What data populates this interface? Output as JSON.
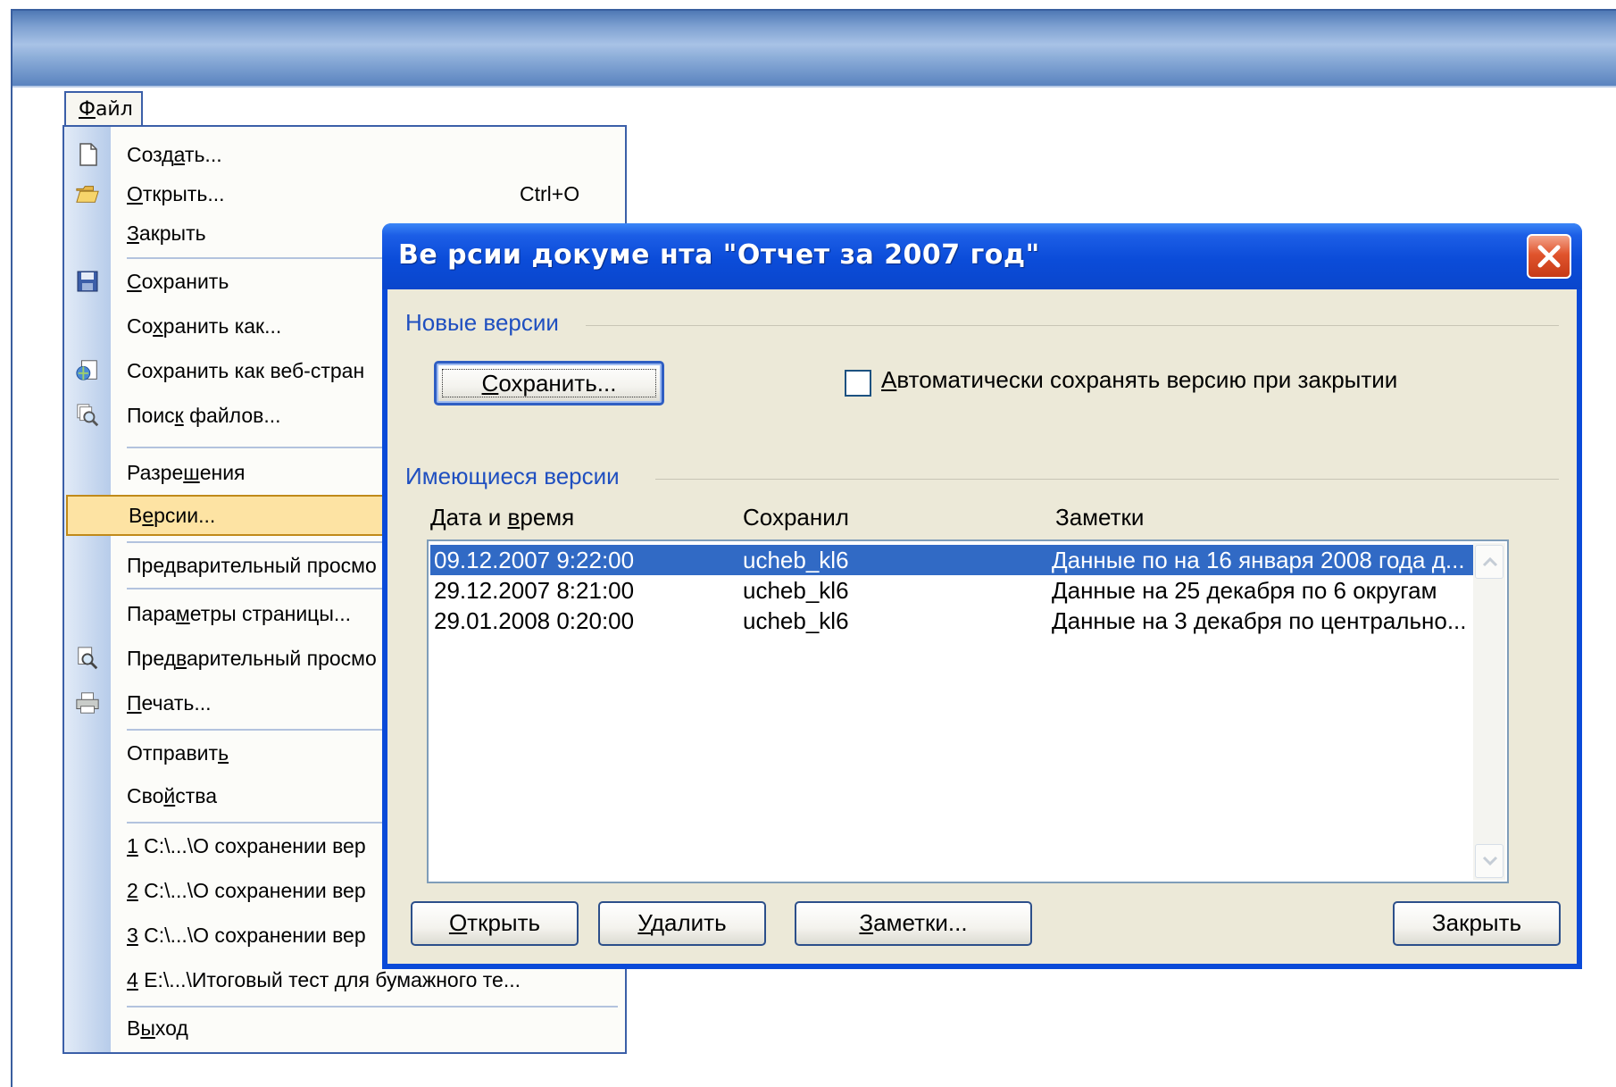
{
  "menu": {
    "tab": {
      "label": "Файл",
      "accel": "Ф",
      "rest": "айл"
    },
    "items": [
      {
        "pre": "Созд",
        "acc": "а",
        "post": "ть...",
        "shortcut": "",
        "icon": "new-document-icon"
      },
      {
        "pre": "",
        "acc": "О",
        "post": "ткрыть...",
        "shortcut": "Ctrl+O",
        "icon": "open-folder-icon"
      },
      {
        "pre": "",
        "acc": "З",
        "post": "акрыть",
        "shortcut": "",
        "icon": ""
      },
      {
        "pre": "",
        "acc": "С",
        "post": "охранить",
        "shortcut": "",
        "icon": "save-disk-icon"
      },
      {
        "pre": "Со",
        "acc": "х",
        "post": "ранить как...",
        "shortcut": "",
        "icon": ""
      },
      {
        "pre": "Сохранить как веб-стран",
        "acc": "",
        "post": "",
        "shortcut": "",
        "icon": "web-page-icon"
      },
      {
        "pre": "Поис",
        "acc": "к",
        "post": " файлов...",
        "shortcut": "",
        "icon": "file-search-icon"
      },
      {
        "pre": "Разре",
        "acc": "ш",
        "post": "ения",
        "shortcut": "",
        "icon": ""
      },
      {
        "pre": "В",
        "acc": "е",
        "post": "рсии...",
        "shortcut": "",
        "icon": ""
      },
      {
        "pre": "Предварительный просмо",
        "acc": "",
        "post": "",
        "shortcut": "",
        "icon": ""
      },
      {
        "pre": "Пара",
        "acc": "м",
        "post": "етры страницы...",
        "shortcut": "",
        "icon": ""
      },
      {
        "pre": "Пред",
        "acc": "в",
        "post": "арительный просмо",
        "shortcut": "",
        "icon": "print-preview-icon"
      },
      {
        "pre": "",
        "acc": "П",
        "post": "ечать...",
        "shortcut": "",
        "icon": "printer-icon"
      },
      {
        "pre": "Отправит",
        "acc": "ь",
        "post": "",
        "shortcut": "",
        "icon": ""
      },
      {
        "pre": "Сво",
        "acc": "й",
        "post": "ства",
        "shortcut": "",
        "icon": ""
      },
      {
        "pre": "",
        "acc": "1",
        "post": " C:\\...\\О сохранении вер",
        "shortcut": "",
        "icon": ""
      },
      {
        "pre": "",
        "acc": "2",
        "post": " C:\\...\\О сохранении вер",
        "shortcut": "",
        "icon": ""
      },
      {
        "pre": "",
        "acc": "3",
        "post": " C:\\...\\О сохранении вер",
        "shortcut": "",
        "icon": ""
      },
      {
        "pre": "",
        "acc": "4",
        "post": " E:\\...\\Итоговый тест для бумажного те...",
        "shortcut": "",
        "icon": ""
      },
      {
        "pre": "В",
        "acc": "ы",
        "post": "ход",
        "shortcut": "",
        "icon": ""
      }
    ]
  },
  "dialog": {
    "title": "Ве рсии докуме нта \"Отчет за 2007 год\"",
    "new_versions_label": "Новые версии",
    "save_button": {
      "pre": "",
      "acc": "С",
      "post": "охранить..."
    },
    "autosave_checkbox": {
      "pre": "",
      "acc": "А",
      "post": "втоматически сохранять версию при закрытии",
      "checked": false
    },
    "existing_versions_label": "Имеющиеся версии",
    "columns": {
      "date": {
        "pre": "Дата и ",
        "acc": "в",
        "post": "ремя"
      },
      "saved_by": "Сохранил",
      "notes": "Заметки"
    },
    "rows": [
      {
        "date": "09.12.2007 9:22:00",
        "saved_by": "ucheb_kl6",
        "notes": "Данные по на 16 января 2008 года д...",
        "selected": true
      },
      {
        "date": "29.12.2007 8:21:00",
        "saved_by": "ucheb_kl6",
        "notes": "Данные на 25 декабря по 6 округам",
        "selected": false
      },
      {
        "date": "29.01.2008 0:20:00",
        "saved_by": "ucheb_kl6",
        "notes": "Данные на 3 декабря по центрально...",
        "selected": false
      }
    ],
    "buttons": {
      "open": {
        "pre": "",
        "acc": "О",
        "post": "ткрыть"
      },
      "delete": {
        "pre": "",
        "acc": "У",
        "post": "далить"
      },
      "notes": {
        "pre": "",
        "acc": "З",
        "post": "аметки..."
      },
      "close": "Закрыть"
    }
  }
}
